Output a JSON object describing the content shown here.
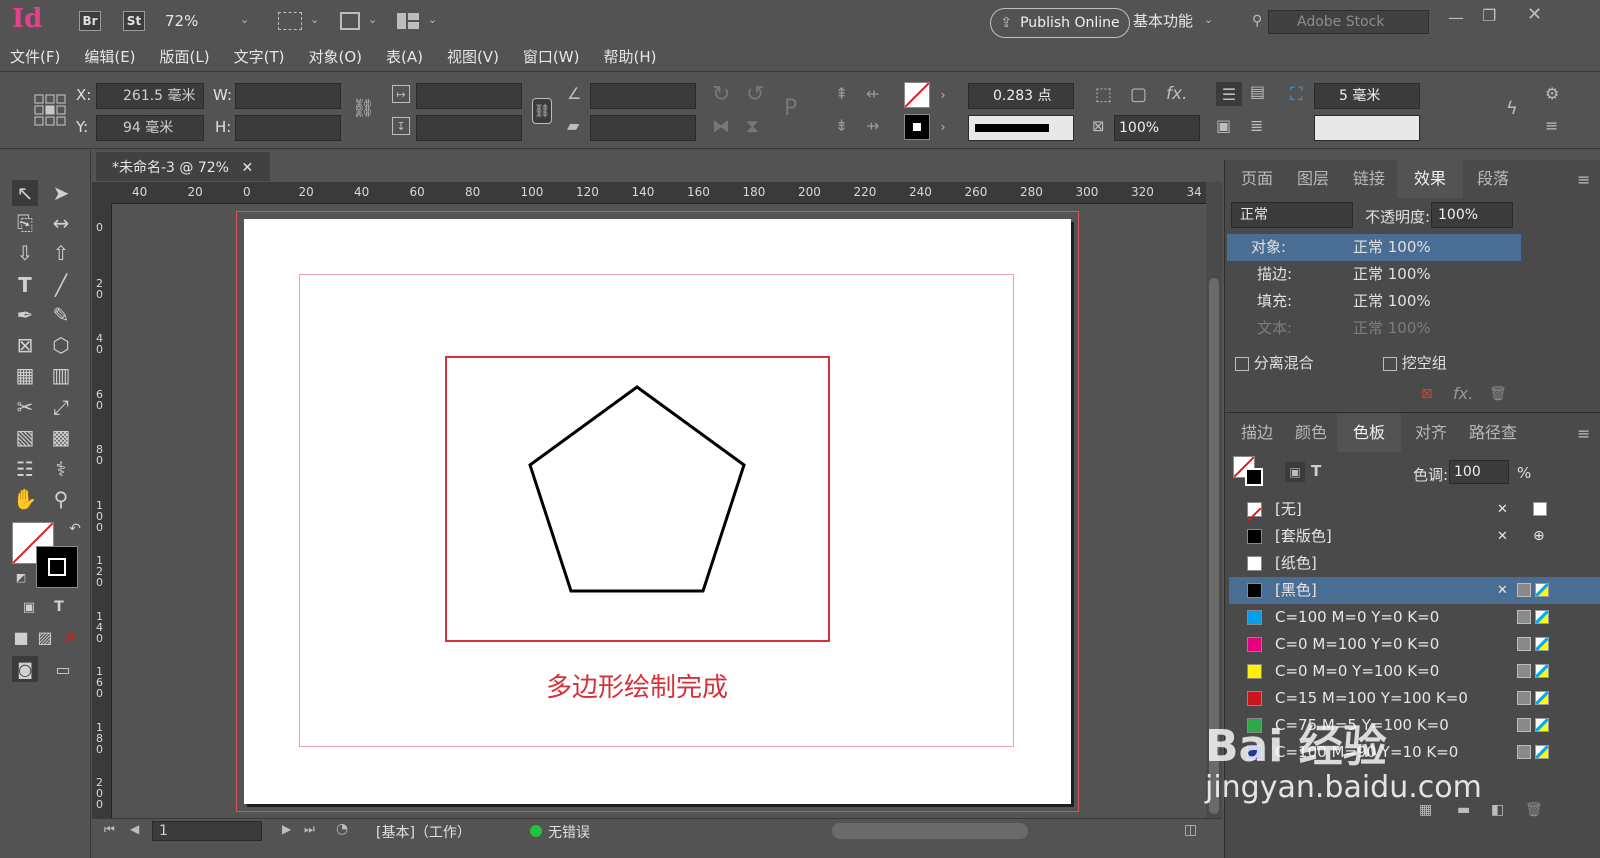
{
  "app": {
    "logo": "Id",
    "bridge": "Br",
    "stock_tile": "St",
    "zoom": "72%",
    "publish_label": "Publish Online",
    "workspace": "基本功能",
    "search_placeholder": "Adobe Stock"
  },
  "menu": [
    "文件(F)",
    "编辑(E)",
    "版面(L)",
    "文字(T)",
    "对象(O)",
    "表(A)",
    "视图(V)",
    "窗口(W)",
    "帮助(H)"
  ],
  "control": {
    "x_label": "X:",
    "x_value": "261.5 毫米",
    "y_label": "Y:",
    "y_value": "94 毫米",
    "w_label": "W:",
    "h_label": "H:",
    "stroke_weight": "0.283 点",
    "opacity": "100%",
    "spacing": "5 毫米"
  },
  "document": {
    "tab_title": "*未命名-3 @ 72%",
    "caption": "多边形绘制完成",
    "ruler_h": [
      "40",
      "20",
      "0",
      "20",
      "40",
      "60",
      "80",
      "100",
      "120",
      "140",
      "160",
      "180",
      "200",
      "220",
      "240",
      "260",
      "280",
      "300",
      "320",
      "34"
    ],
    "ruler_v": [
      "0",
      "2 0",
      "4 0",
      "6 0",
      "8 0",
      "1 0 0",
      "1 2 0",
      "1 4 0",
      "1 6 0",
      "1 8 0",
      "2 0 0"
    ]
  },
  "status": {
    "page": "1",
    "preflight_profile": "[基本]（工作）",
    "errors": "无错误"
  },
  "effects_panel": {
    "tabs": [
      "页面",
      "图层",
      "链接",
      "效果",
      "段落"
    ],
    "active_tab": "效果",
    "blend_mode": "正常",
    "opacity_label": "不透明度:",
    "opacity_value": "100%",
    "rows": [
      {
        "label": "对象:",
        "value": "正常 100%"
      },
      {
        "label": "描边:",
        "value": "正常 100%"
      },
      {
        "label": "填充:",
        "value": "正常 100%"
      },
      {
        "label": "文本:",
        "value": "正常 100%"
      }
    ],
    "isolate": "分离混合",
    "knockout": "挖空组"
  },
  "swatches_panel": {
    "tabs": [
      "描边",
      "颜色",
      "色板",
      "对齐",
      "路径查"
    ],
    "active_tab": "色板",
    "tint_label": "色调:",
    "tint_value": "100",
    "percent": "%",
    "items": [
      {
        "name": "[无]",
        "color": "none"
      },
      {
        "name": "[套版色]",
        "color": "#000000"
      },
      {
        "name": "[纸色]",
        "color": "#ffffff"
      },
      {
        "name": "[黑色]",
        "color": "#000000"
      },
      {
        "name": "C=100 M=0 Y=0 K=0",
        "color": "#00a0e9"
      },
      {
        "name": "C=0 M=100 Y=0 K=0",
        "color": "#e4007f"
      },
      {
        "name": "C=0 M=0 Y=100 K=0",
        "color": "#fff100"
      },
      {
        "name": "C=15 M=100 Y=100 K=0",
        "color": "#c9161d"
      },
      {
        "name": "C=75 M=5 Y=100 K=0",
        "color": "#2ba84a"
      },
      {
        "name": "C=100 M=90 Y=10 K=0",
        "color": "#1d3a8f"
      }
    ]
  },
  "watermark": {
    "brand": "Bai 经验",
    "url": "jingyan.baidu.com"
  },
  "colors": {
    "accent_red": "#d5313b",
    "selected_row": "#4a6d94"
  }
}
